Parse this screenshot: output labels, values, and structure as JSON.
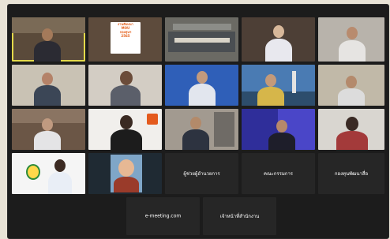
{
  "tiles": [
    {
      "caption": "",
      "active": true
    },
    {
      "caption": "",
      "active": false,
      "poster": [
        "งานสัมมนา",
        "MOU",
        "กองทุนฯ",
        "2565"
      ]
    },
    {
      "caption": "",
      "active": false
    },
    {
      "caption": "",
      "active": false
    },
    {
      "caption": "",
      "active": false
    },
    {
      "caption": "",
      "active": false
    },
    {
      "caption": "",
      "active": false
    },
    {
      "caption": "",
      "active": false
    },
    {
      "caption": "",
      "active": false
    },
    {
      "caption": "",
      "active": false
    },
    {
      "caption": "",
      "active": false
    },
    {
      "caption": "",
      "active": false
    },
    {
      "caption": "",
      "active": false
    },
    {
      "caption": "",
      "active": false
    },
    {
      "caption": "",
      "active": false
    },
    {
      "caption": "",
      "active": false
    },
    {
      "caption": "",
      "active": false
    },
    {
      "caption": "",
      "active": false
    },
    {
      "caption": "",
      "active": false
    },
    {
      "caption": "",
      "active": false
    },
    {
      "caption": "",
      "active": false
    }
  ],
  "name_tiles": [
    {
      "name": "ผู้ช่วยผู้อำนวยการ",
      "caption": ""
    },
    {
      "name": "คณะกรรมการ",
      "caption": ""
    },
    {
      "name": "กองทุนพัฒนาสื่อ",
      "caption": ""
    },
    {
      "name": "e-meeting.com",
      "caption": ""
    },
    {
      "name": "เจ้าหน้าที่สำนักงาน",
      "caption": ""
    }
  ],
  "colors": {
    "active_outline": "#e3d94a",
    "muted_mic": "#ff4a4a"
  }
}
